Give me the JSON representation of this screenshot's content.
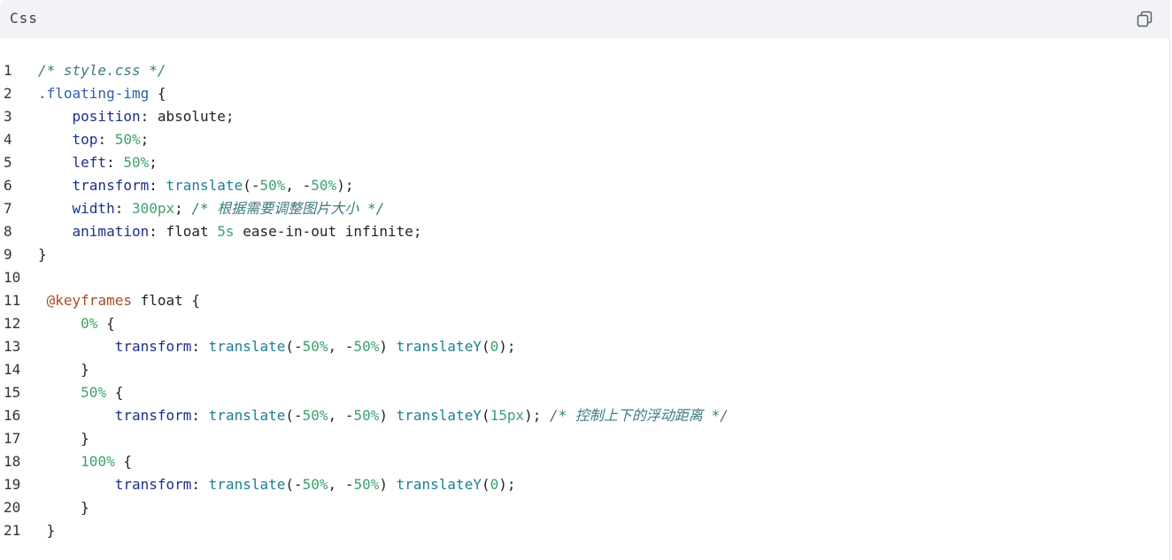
{
  "header": {
    "language": "Css",
    "copy_icon": "copy-icon"
  },
  "lines": [
    {
      "n": "1",
      "tokens": [
        {
          "t": "/* style.css */",
          "c": "comment"
        }
      ]
    },
    {
      "n": "2",
      "tokens": [
        {
          "t": ".floating-img",
          "c": "selector"
        },
        {
          "t": " {",
          "c": "plain"
        }
      ]
    },
    {
      "n": "3",
      "tokens": [
        {
          "t": "    ",
          "c": "plain"
        },
        {
          "t": "position",
          "c": "prop"
        },
        {
          "t": ": absolute;",
          "c": "plain"
        }
      ]
    },
    {
      "n": "4",
      "tokens": [
        {
          "t": "    ",
          "c": "plain"
        },
        {
          "t": "top",
          "c": "prop"
        },
        {
          "t": ": ",
          "c": "plain"
        },
        {
          "t": "50%",
          "c": "num"
        },
        {
          "t": ";",
          "c": "plain"
        }
      ]
    },
    {
      "n": "5",
      "tokens": [
        {
          "t": "    ",
          "c": "plain"
        },
        {
          "t": "left",
          "c": "prop"
        },
        {
          "t": ": ",
          "c": "plain"
        },
        {
          "t": "50%",
          "c": "num"
        },
        {
          "t": ";",
          "c": "plain"
        }
      ]
    },
    {
      "n": "6",
      "tokens": [
        {
          "t": "    ",
          "c": "plain"
        },
        {
          "t": "transform",
          "c": "prop"
        },
        {
          "t": ": ",
          "c": "plain"
        },
        {
          "t": "translate",
          "c": "func"
        },
        {
          "t": "(-",
          "c": "plain"
        },
        {
          "t": "50%",
          "c": "num"
        },
        {
          "t": ", -",
          "c": "plain"
        },
        {
          "t": "50%",
          "c": "num"
        },
        {
          "t": ");",
          "c": "plain"
        }
      ]
    },
    {
      "n": "7",
      "tokens": [
        {
          "t": "    ",
          "c": "plain"
        },
        {
          "t": "width",
          "c": "prop"
        },
        {
          "t": ": ",
          "c": "plain"
        },
        {
          "t": "300px",
          "c": "num"
        },
        {
          "t": "; ",
          "c": "plain"
        },
        {
          "t": "/* 根据需要调整图片大小 */",
          "c": "comment"
        }
      ]
    },
    {
      "n": "8",
      "tokens": [
        {
          "t": "    ",
          "c": "plain"
        },
        {
          "t": "animation",
          "c": "prop"
        },
        {
          "t": ": float ",
          "c": "plain"
        },
        {
          "t": "5s",
          "c": "num"
        },
        {
          "t": " ease-in-out infinite;",
          "c": "plain"
        }
      ]
    },
    {
      "n": "9",
      "tokens": [
        {
          "t": "}",
          "c": "plain"
        }
      ]
    },
    {
      "n": "10",
      "tokens": []
    },
    {
      "n": "11",
      "tokens": [
        {
          "t": " ",
          "c": "plain"
        },
        {
          "t": "@keyframes",
          "c": "at"
        },
        {
          "t": " float {",
          "c": "plain"
        }
      ]
    },
    {
      "n": "12",
      "tokens": [
        {
          "t": "     ",
          "c": "plain"
        },
        {
          "t": "0%",
          "c": "num"
        },
        {
          "t": " {",
          "c": "plain"
        }
      ]
    },
    {
      "n": "13",
      "tokens": [
        {
          "t": "         ",
          "c": "plain"
        },
        {
          "t": "transform",
          "c": "prop"
        },
        {
          "t": ": ",
          "c": "plain"
        },
        {
          "t": "translate",
          "c": "func"
        },
        {
          "t": "(-",
          "c": "plain"
        },
        {
          "t": "50%",
          "c": "num"
        },
        {
          "t": ", -",
          "c": "plain"
        },
        {
          "t": "50%",
          "c": "num"
        },
        {
          "t": ") ",
          "c": "plain"
        },
        {
          "t": "translateY",
          "c": "func"
        },
        {
          "t": "(",
          "c": "plain"
        },
        {
          "t": "0",
          "c": "num"
        },
        {
          "t": ");",
          "c": "plain"
        }
      ]
    },
    {
      "n": "14",
      "tokens": [
        {
          "t": "     }",
          "c": "plain"
        }
      ]
    },
    {
      "n": "15",
      "tokens": [
        {
          "t": "     ",
          "c": "plain"
        },
        {
          "t": "50%",
          "c": "num"
        },
        {
          "t": " {",
          "c": "plain"
        }
      ]
    },
    {
      "n": "16",
      "tokens": [
        {
          "t": "         ",
          "c": "plain"
        },
        {
          "t": "transform",
          "c": "prop"
        },
        {
          "t": ": ",
          "c": "plain"
        },
        {
          "t": "translate",
          "c": "func"
        },
        {
          "t": "(-",
          "c": "plain"
        },
        {
          "t": "50%",
          "c": "num"
        },
        {
          "t": ", -",
          "c": "plain"
        },
        {
          "t": "50%",
          "c": "num"
        },
        {
          "t": ") ",
          "c": "plain"
        },
        {
          "t": "translateY",
          "c": "func"
        },
        {
          "t": "(",
          "c": "plain"
        },
        {
          "t": "15px",
          "c": "num"
        },
        {
          "t": "); ",
          "c": "plain"
        },
        {
          "t": "/* 控制上下的浮动距离 */",
          "c": "comment"
        }
      ]
    },
    {
      "n": "17",
      "tokens": [
        {
          "t": "     }",
          "c": "plain"
        }
      ]
    },
    {
      "n": "18",
      "tokens": [
        {
          "t": "     ",
          "c": "plain"
        },
        {
          "t": "100%",
          "c": "num"
        },
        {
          "t": " {",
          "c": "plain"
        }
      ]
    },
    {
      "n": "19",
      "tokens": [
        {
          "t": "         ",
          "c": "plain"
        },
        {
          "t": "transform",
          "c": "prop"
        },
        {
          "t": ": ",
          "c": "plain"
        },
        {
          "t": "translate",
          "c": "func"
        },
        {
          "t": "(-",
          "c": "plain"
        },
        {
          "t": "50%",
          "c": "num"
        },
        {
          "t": ", -",
          "c": "plain"
        },
        {
          "t": "50%",
          "c": "num"
        },
        {
          "t": ") ",
          "c": "plain"
        },
        {
          "t": "translateY",
          "c": "func"
        },
        {
          "t": "(",
          "c": "plain"
        },
        {
          "t": "0",
          "c": "num"
        },
        {
          "t": ");",
          "c": "plain"
        }
      ]
    },
    {
      "n": "20",
      "tokens": [
        {
          "t": "     }",
          "c": "plain"
        }
      ]
    },
    {
      "n": "21",
      "tokens": [
        {
          "t": " }",
          "c": "plain"
        }
      ]
    }
  ]
}
